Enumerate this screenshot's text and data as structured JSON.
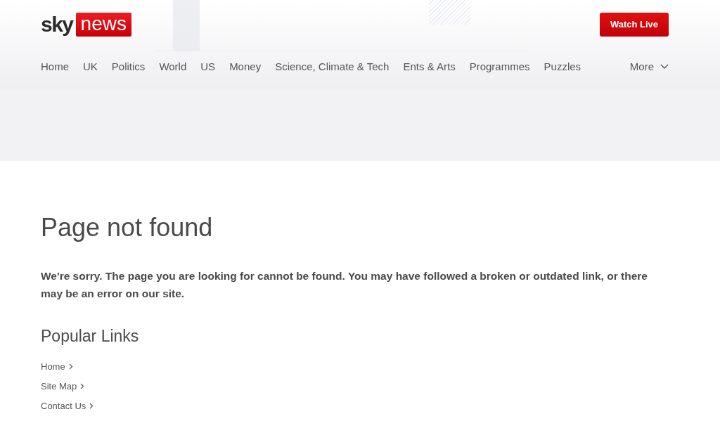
{
  "logo": {
    "sky": "sky",
    "news": "news"
  },
  "watch_live": "Watch Live",
  "nav": {
    "items": [
      "Home",
      "UK",
      "Politics",
      "World",
      "US",
      "Money",
      "Science, Climate & Tech",
      "Ents & Arts",
      "Programmes",
      "Puzzles"
    ],
    "more": "More"
  },
  "title": "Page not found",
  "message": "We're sorry. The page you are looking for cannot be found. You may have followed a broken or outdated link, or there may be an error on our site.",
  "popular_links": {
    "heading": "Popular Links",
    "links": [
      "Home",
      "Site Map",
      "Contact Us"
    ]
  }
}
